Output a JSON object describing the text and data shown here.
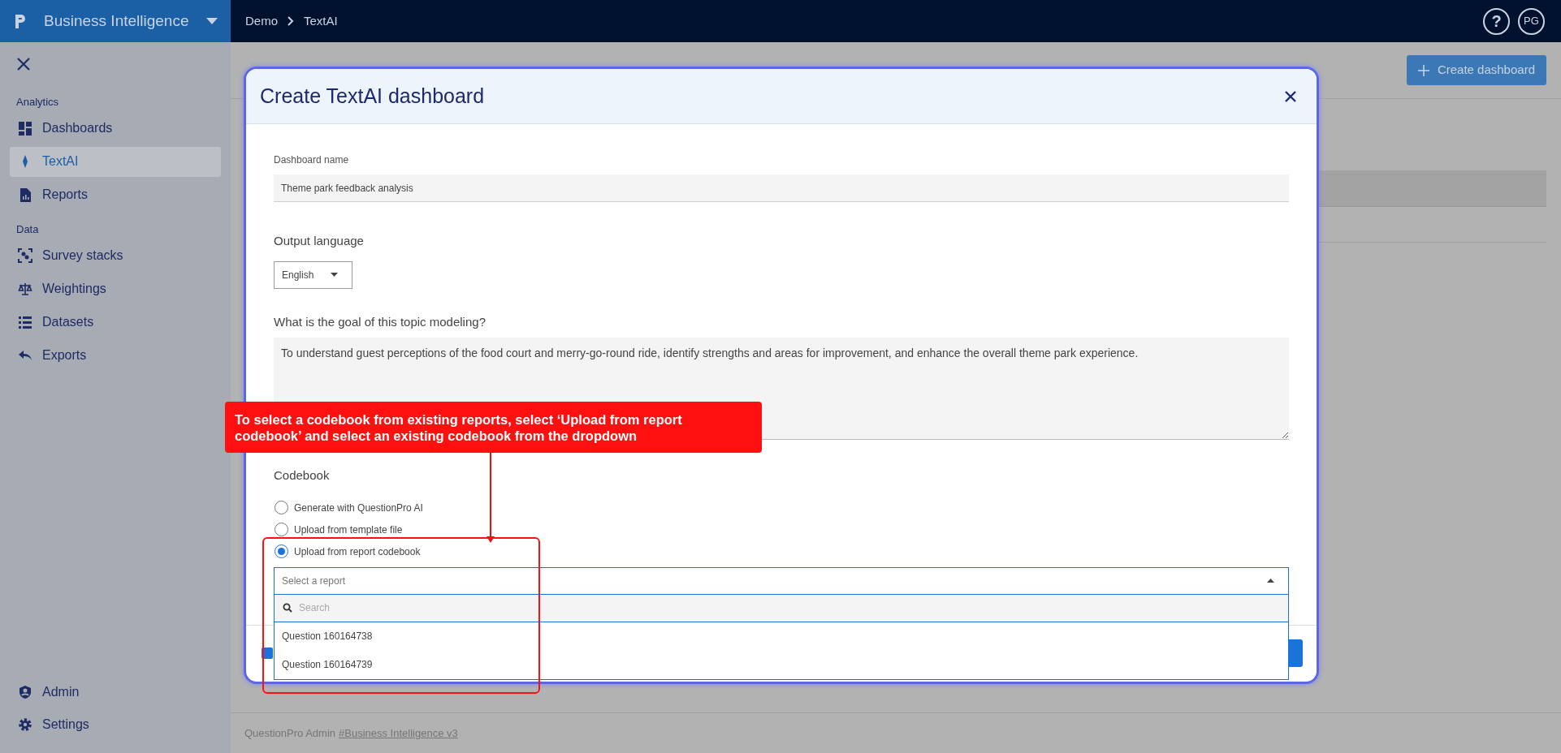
{
  "app": {
    "brand": "Business Intelligence"
  },
  "breadcrumb": [
    "Demo",
    "TextAI"
  ],
  "user": {
    "help": "?",
    "initials": "PG"
  },
  "sidebar": {
    "sections": [
      {
        "title": "Analytics",
        "items": [
          {
            "label": "Dashboards",
            "selected": false
          },
          {
            "label": "TextAI",
            "selected": true
          },
          {
            "label": "Reports",
            "selected": false
          }
        ]
      },
      {
        "title": "Data",
        "items": [
          {
            "label": "Survey stacks",
            "selected": false
          },
          {
            "label": "Weightings",
            "selected": false
          },
          {
            "label": "Datasets",
            "selected": false
          },
          {
            "label": "Exports",
            "selected": false
          }
        ]
      }
    ],
    "bottom_items": [
      {
        "label": "Admin",
        "selected": false
      },
      {
        "label": "Settings",
        "selected": false
      }
    ]
  },
  "page": {
    "primary_button": "Create dashboard"
  },
  "modal": {
    "title": "Create TextAI dashboard",
    "dashboard_name": {
      "label": "Dashboard name",
      "value": "Theme park feedback analysis"
    },
    "output_language": {
      "label": "Output language",
      "value": "English"
    },
    "goal": {
      "label": "What is the goal of this topic modeling?",
      "value": "To understand guest perceptions of the food court and merry-go-round ride, identify strengths and areas for improvement, and enhance the overall theme park experience."
    },
    "codebook": {
      "label": "Codebook",
      "options": [
        {
          "label": "Generate with QuestionPro AI",
          "selected": false
        },
        {
          "label": "Upload from template file",
          "selected": false
        },
        {
          "label": "Upload from report codebook",
          "selected": true
        }
      ],
      "report_select": {
        "placeholder": "Select a report",
        "expanded": true,
        "search_placeholder": "Search",
        "options": [
          "Question 160164738",
          "Question 160164739"
        ]
      }
    }
  },
  "footer_checkbox": {
    "checked": true
  },
  "annotation": {
    "text": "To select a codebook from existing reports, select ‘Upload from report codebook’ and select an existing codebook from the dropdown"
  },
  "footer": {
    "text": "QuestionPro Admin",
    "link": "#Business Intelligence v3"
  }
}
